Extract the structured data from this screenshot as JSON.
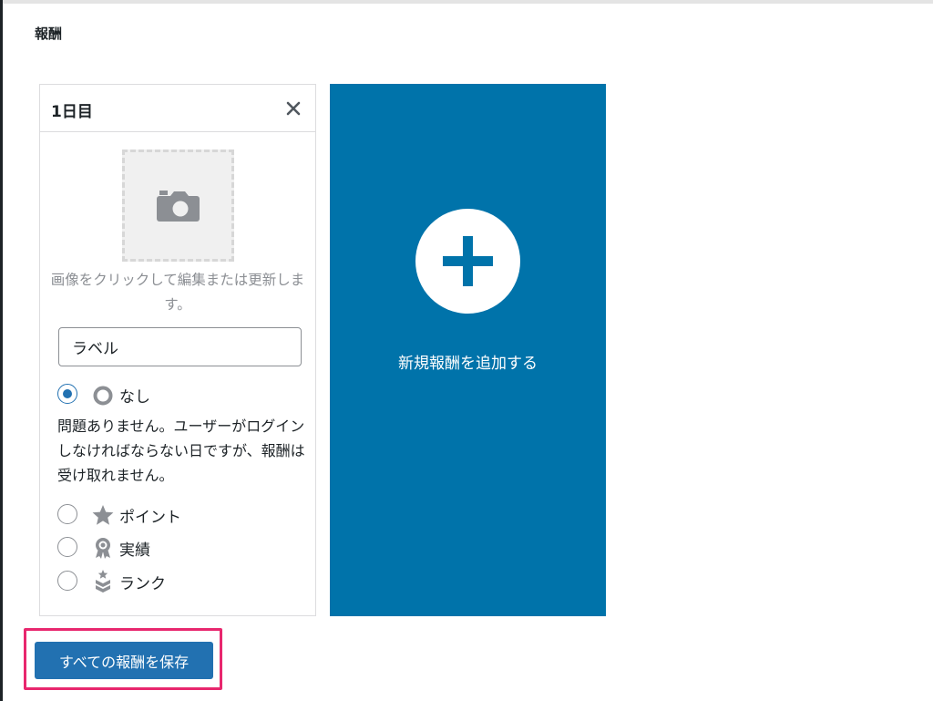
{
  "section": {
    "title": "報酬"
  },
  "reward_card": {
    "title": "1日目",
    "close_label": "×",
    "image_hint": "画像をクリックして編集または更新します。",
    "label_input": {
      "value": "ラベル",
      "placeholder": ""
    },
    "options": [
      {
        "label": "なし",
        "icon": "ring-icon",
        "checked": true
      },
      {
        "label": "ポイント",
        "icon": "star-icon",
        "checked": false
      },
      {
        "label": "実績",
        "icon": "award-icon",
        "checked": false
      },
      {
        "label": "ランク",
        "icon": "rank-icon",
        "checked": false
      }
    ],
    "description": "問題ありません。ユーザーがログインしなければならない日ですが、報酬は受け取れません。"
  },
  "add_card": {
    "label": "新規報酬を追加する"
  },
  "footer": {
    "save_label": "すべての報酬を保存"
  },
  "colors": {
    "primary": "#2271b1",
    "add_card_bg": "#0073aa",
    "highlight": "#e8276e",
    "border": "#dcdcde",
    "muted_text": "#8c8f94"
  }
}
